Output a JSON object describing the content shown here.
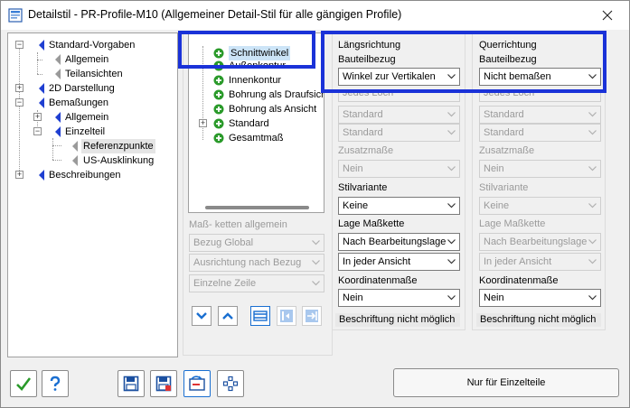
{
  "window": {
    "title": "Detailstil - PR-Profile-M10 (Allgemeiner Detail-Stil für alle gängigen Profile)"
  },
  "tree": {
    "items": [
      {
        "label": "Standard-Vorgaben"
      },
      {
        "label": "Allgemein"
      },
      {
        "label": "Teilansichten"
      },
      {
        "label": "2D Darstellung"
      },
      {
        "label": "Bemaßungen"
      },
      {
        "label": "Allgemein"
      },
      {
        "label": "Einzelteil"
      },
      {
        "label": "Referenzpunkte"
      },
      {
        "label": "US-Ausklinkung"
      },
      {
        "label": "Beschreibungen"
      }
    ]
  },
  "list": {
    "items": [
      {
        "label": "Schnittwinkel"
      },
      {
        "label": "Außenkontur"
      },
      {
        "label": "Innenkontur"
      },
      {
        "label": "Bohrung als Draufsicht"
      },
      {
        "label": "Bohrung als Ansicht"
      },
      {
        "label": "Standard"
      },
      {
        "label": "Gesamtmaß"
      }
    ]
  },
  "left_controls": {
    "heading": "Maß- ketten allgemein",
    "combos": [
      "Bezug Global",
      "Ausrichtung nach Bezug",
      "Einzelne Zeile"
    ]
  },
  "laengs": {
    "title": "Längsrichtung",
    "bauteilbezug_label": "Bauteilbezug",
    "bauteilbezug": "Winkel zur Vertikalen",
    "jedes_loch": "Jedes Loch",
    "standard1": "Standard",
    "standard2": "Standard",
    "zusatz_label": "Zusatzmaße",
    "zusatz": "Nein",
    "stil_label": "Stilvariante",
    "stil": "Keine",
    "lage_label": "Lage Maßkette",
    "lage1": "Nach Bearbeitungslage",
    "lage2": "In jeder Ansicht",
    "koord_label": "Koordinatenmaße",
    "koord": "Nein",
    "beschriftung": "Beschriftung nicht möglich"
  },
  "quer": {
    "title": "Querrichtung",
    "bauteilbezug_label": "Bauteilbezug",
    "bauteilbezug": "Nicht bemaßen",
    "jedes_loch": "Jedes Loch",
    "standard1": "Standard",
    "standard2": "Standard",
    "zusatz_label": "Zusatzmaße",
    "zusatz": "Nein",
    "stil_label": "Stilvariante",
    "stil": "Keine",
    "lage_label": "Lage Maßkette",
    "lage1": "Nach Bearbeitungslage",
    "lage2": "In jeder Ansicht",
    "koord_label": "Koordinatenmaße",
    "koord": "Nein",
    "beschriftung": "Beschriftung nicht möglich"
  },
  "footer": {
    "nur_label": "Nur für Einzelteile"
  },
  "colors": {
    "accent_frame": "#1a32d8",
    "tree_flag": "#1f3fd1",
    "plus_green": "#2a9a2a"
  }
}
